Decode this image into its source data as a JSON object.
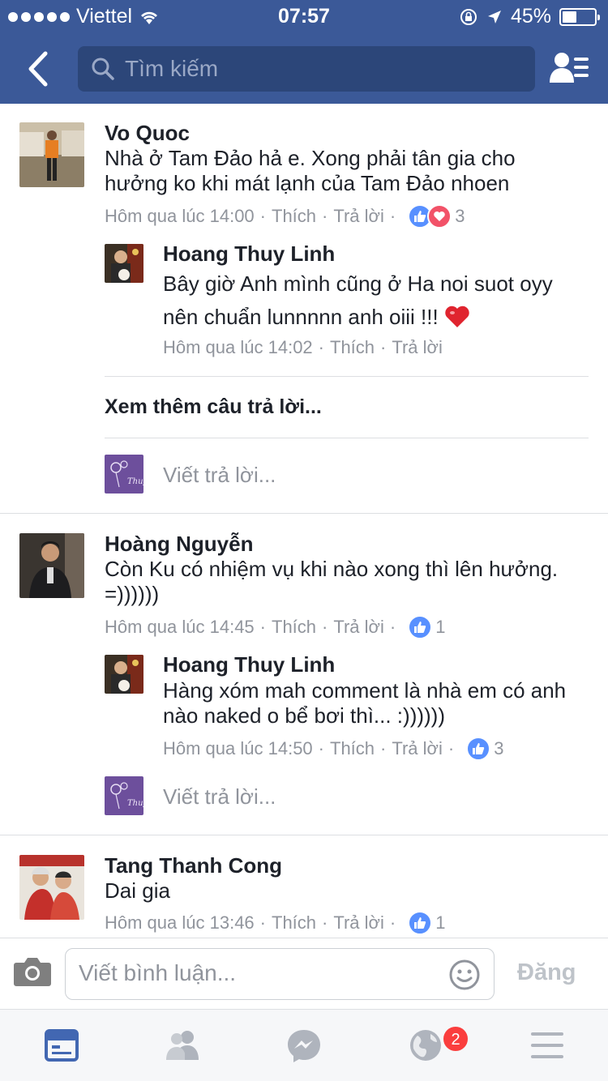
{
  "status_bar": {
    "carrier": "Viettel",
    "time": "07:57",
    "battery": "45%",
    "battery_level": 0.45
  },
  "nav": {
    "search_placeholder": "Tìm kiếm"
  },
  "comments": [
    {
      "author": "Vo Quoc",
      "text": "Nhà ở Tam Đảo hả e. Xong phải tân gia cho hưởng ko khi mát lạnh của Tam Đảo nhoen",
      "time": "Hôm qua lúc 14:00",
      "like": "Thích",
      "reply": "Trả lời",
      "reactions": "3",
      "replies": [
        {
          "author": "Hoang Thuy Linh",
          "text": "Bây giờ Anh mình cũng ở Ha noi suot oyy nên chuẩn lunnnnn anh oiii !!!",
          "time": "Hôm qua lúc 14:02",
          "like": "Thích",
          "reply": "Trả lời"
        }
      ],
      "more_replies": "Xem thêm câu trả lời...",
      "reply_placeholder": "Viết trả lời..."
    },
    {
      "author": "Hoàng Nguyễn",
      "text": "Còn Ku có nhiệm vụ khi nào xong thì lên hưởng. =))))))",
      "time": "Hôm qua lúc 14:45",
      "like": "Thích",
      "reply": "Trả lời",
      "reactions": "1",
      "replies": [
        {
          "author": "Hoang Thuy Linh",
          "text": "Hàng xóm mah comment là nhà em có anh nào naked o bể bơi thì... :))))))",
          "time": "Hôm qua lúc 14:50",
          "like": "Thích",
          "reply": "Trả lời",
          "reactions": "3"
        }
      ],
      "reply_placeholder": "Viết trả lời..."
    },
    {
      "author": "Tang Thanh Cong",
      "text": "Dai gia",
      "time": "Hôm qua lúc 13:46",
      "like": "Thích",
      "reply": "Trả lời",
      "reactions": "1"
    }
  ],
  "composer": {
    "placeholder": "Viết bình luận...",
    "post_label": "Đăng"
  },
  "tabbar": {
    "notifications_badge": "2"
  },
  "colors": {
    "brand": "#3b5998",
    "search_bg": "#2c4679",
    "like_blue": "#5890ff",
    "love_red": "#f25268",
    "meta_gray": "#90949c",
    "badge_red": "#fa3e3e"
  }
}
